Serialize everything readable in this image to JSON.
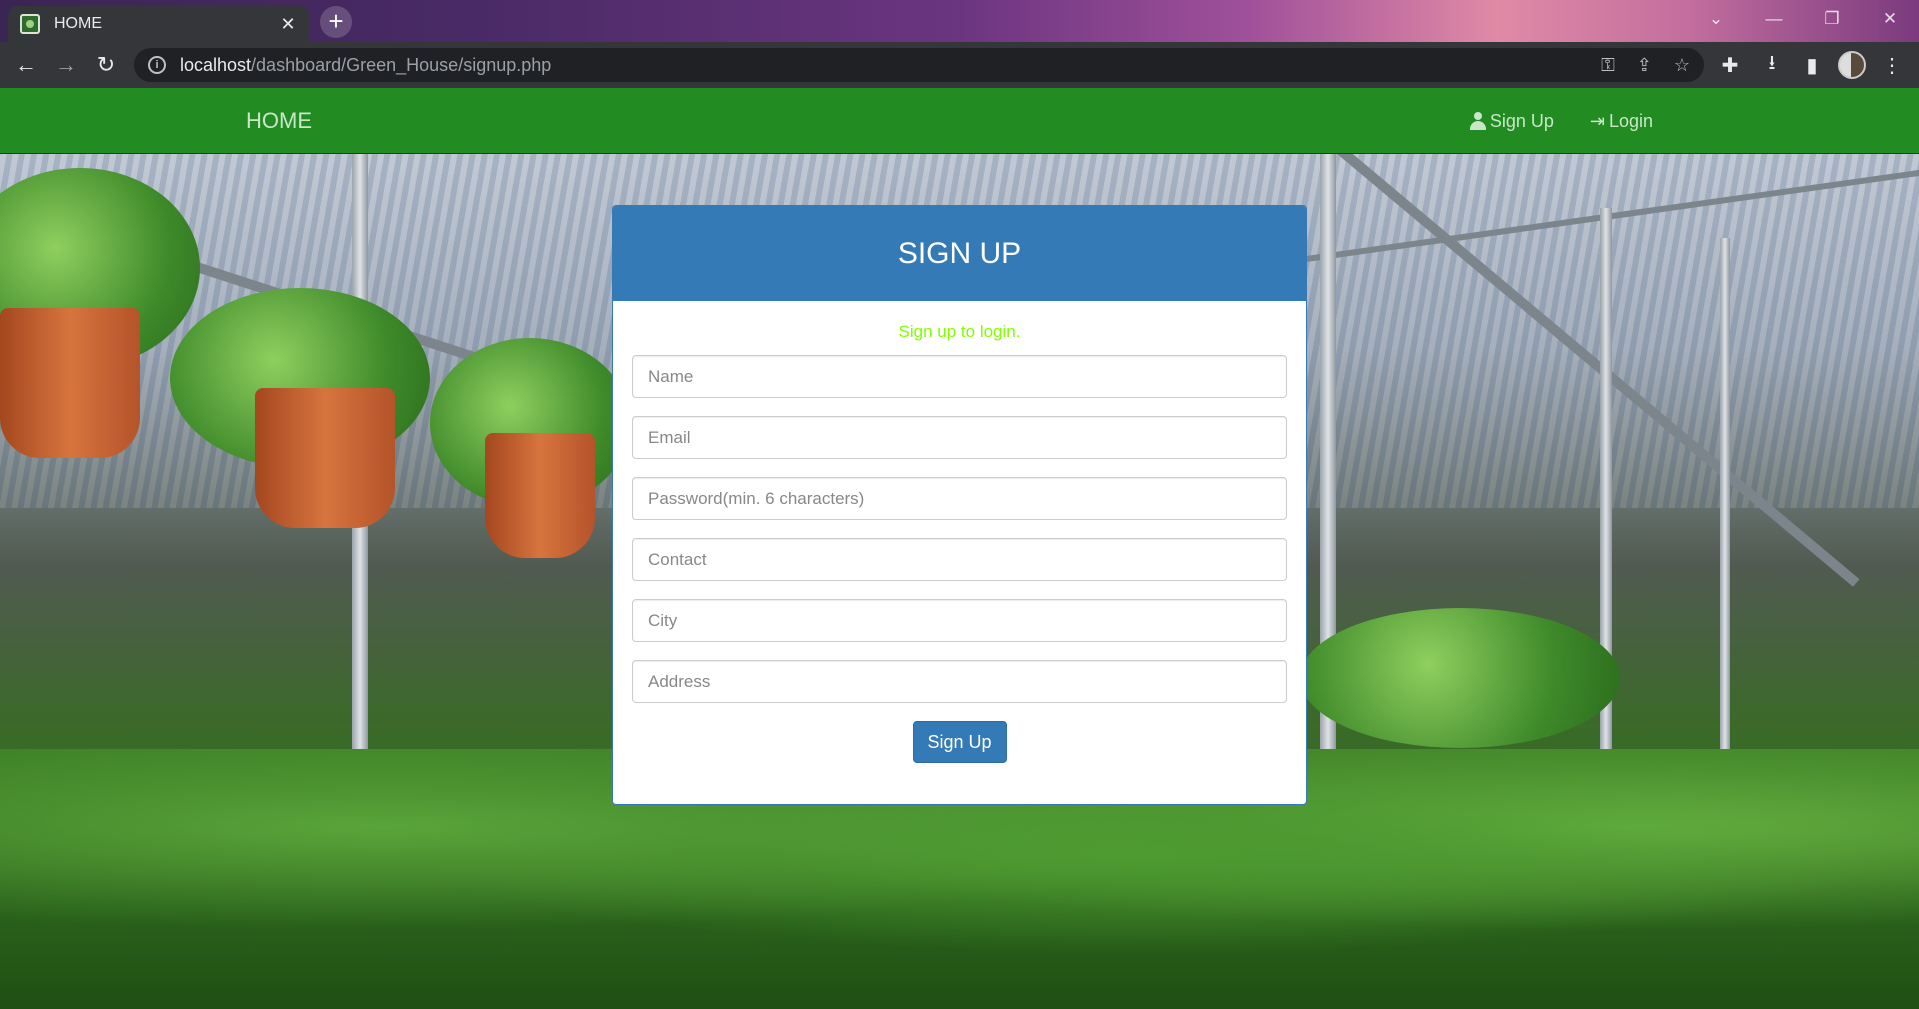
{
  "browser": {
    "tab_title": "HOME",
    "tab_close": "✕",
    "new_tab": "+",
    "url_host": "localhost",
    "url_path": "/dashboard/Green_House/signup.php",
    "info_glyph": "i"
  },
  "navbar": {
    "brand": "HOME",
    "signup_label": "Sign Up",
    "login_label": "Login",
    "color": "#228b22"
  },
  "panel": {
    "title": "SIGN UP",
    "hint": "Sign up to login.",
    "header_color": "#337ab7",
    "fields": {
      "name_placeholder": "Name",
      "email_placeholder": "Email",
      "password_placeholder": "Password(min. 6 characters)",
      "contact_placeholder": "Contact",
      "city_placeholder": "City",
      "address_placeholder": "Address"
    },
    "submit_label": "Sign Up"
  }
}
